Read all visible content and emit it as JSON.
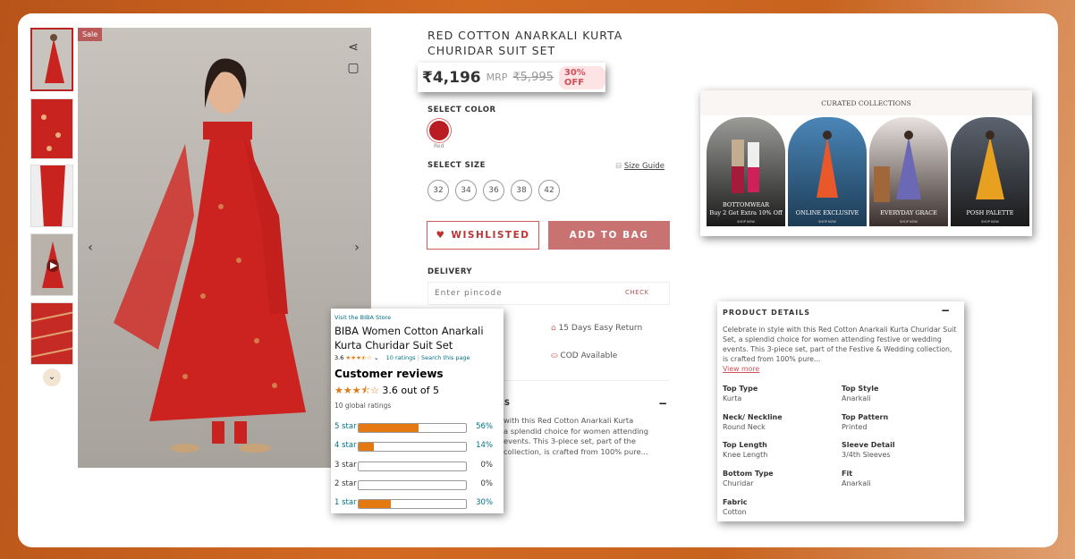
{
  "gallery": {
    "sale_badge": "Sale",
    "thumbnails": 5
  },
  "product": {
    "title": "RED COTTON ANARKALI KURTA CHURIDAR SUIT SET",
    "price": "₹4,196",
    "mrp_label": "MRP",
    "mrp": "₹5,995",
    "discount": "30% OFF",
    "color_label": "SELECT COLOR",
    "color_name": "Red",
    "color_hex": "#b91c22",
    "size_label": "SELECT SIZE",
    "size_guide": "Size Guide",
    "sizes": [
      "32",
      "34",
      "36",
      "38",
      "42"
    ],
    "wishlist": "WISHLISTED",
    "add_to_bag": "ADD TO BAG",
    "delivery_label": "DELIVERY",
    "pincode_placeholder": "Enter pincode",
    "check": "CHECK",
    "return_text": "15 Days Easy Return",
    "cod_text": "COD Available",
    "details_partial": "LS",
    "desc_partial": [
      "with this Red Cotton Anarkali Kurta",
      "a splendid choice for women attending",
      "events. This 3-piece set, part of the",
      "collection, is crafted from 100% pure..."
    ]
  },
  "reviews": {
    "store_link": "Visit the BIBA Store",
    "title": "BIBA Women Cotton Anarkali Kurta Churidar Suit Set",
    "rating": "3.6",
    "ratings_link": "10 ratings",
    "search_link": "Search this page",
    "heading": "Customer reviews",
    "out_of": "3.6 out of 5",
    "global": "10 global ratings",
    "bars": [
      {
        "label": "5 star",
        "pct": 56,
        "text": "56%"
      },
      {
        "label": "4 star",
        "pct": 14,
        "text": "14%"
      },
      {
        "label": "3 star",
        "pct": 0,
        "text": "0%"
      },
      {
        "label": "2 star",
        "pct": 0,
        "text": "0%"
      },
      {
        "label": "1 star",
        "pct": 30,
        "text": "30%"
      }
    ],
    "accent": "#e47911"
  },
  "collections": {
    "title": "CURATED COLLECTIONS",
    "items": [
      {
        "name": "BOTTOMWEAR",
        "sub": "Buy 2 Get Extra 10% Off",
        "shop": "SHOP NOW"
      },
      {
        "name": "ONLINE EXCLUSIVE",
        "shop": "SHOP NOW"
      },
      {
        "name": "EVERYDAY GRACE",
        "shop": "SHOP NOW"
      },
      {
        "name": "POSH PALETTE",
        "shop": "SHOP NOW"
      }
    ]
  },
  "details": {
    "title": "PRODUCT DETAILS",
    "description": "Celebrate in style with this Red Cotton Anarkali Kurta Churidar Suit Set, a splendid choice for women attending festive or wedding events. This 3-piece set, part of the Festive & Wedding collection, is crafted from 100% pure...",
    "view_more": "View more",
    "attrs": [
      {
        "k": "Top Type",
        "v": "Kurta"
      },
      {
        "k": "Top Style",
        "v": "Anarkali"
      },
      {
        "k": "Neck/ Neckline",
        "v": "Round Neck"
      },
      {
        "k": "Top Pattern",
        "v": "Printed"
      },
      {
        "k": "Top Length",
        "v": "Knee Length"
      },
      {
        "k": "Sleeve Detail",
        "v": "3/4th Sleeves"
      },
      {
        "k": "Bottom Type",
        "v": "Churidar"
      },
      {
        "k": "Fit",
        "v": "Anarkali"
      },
      {
        "k": "Fabric",
        "v": "Cotton"
      }
    ]
  }
}
